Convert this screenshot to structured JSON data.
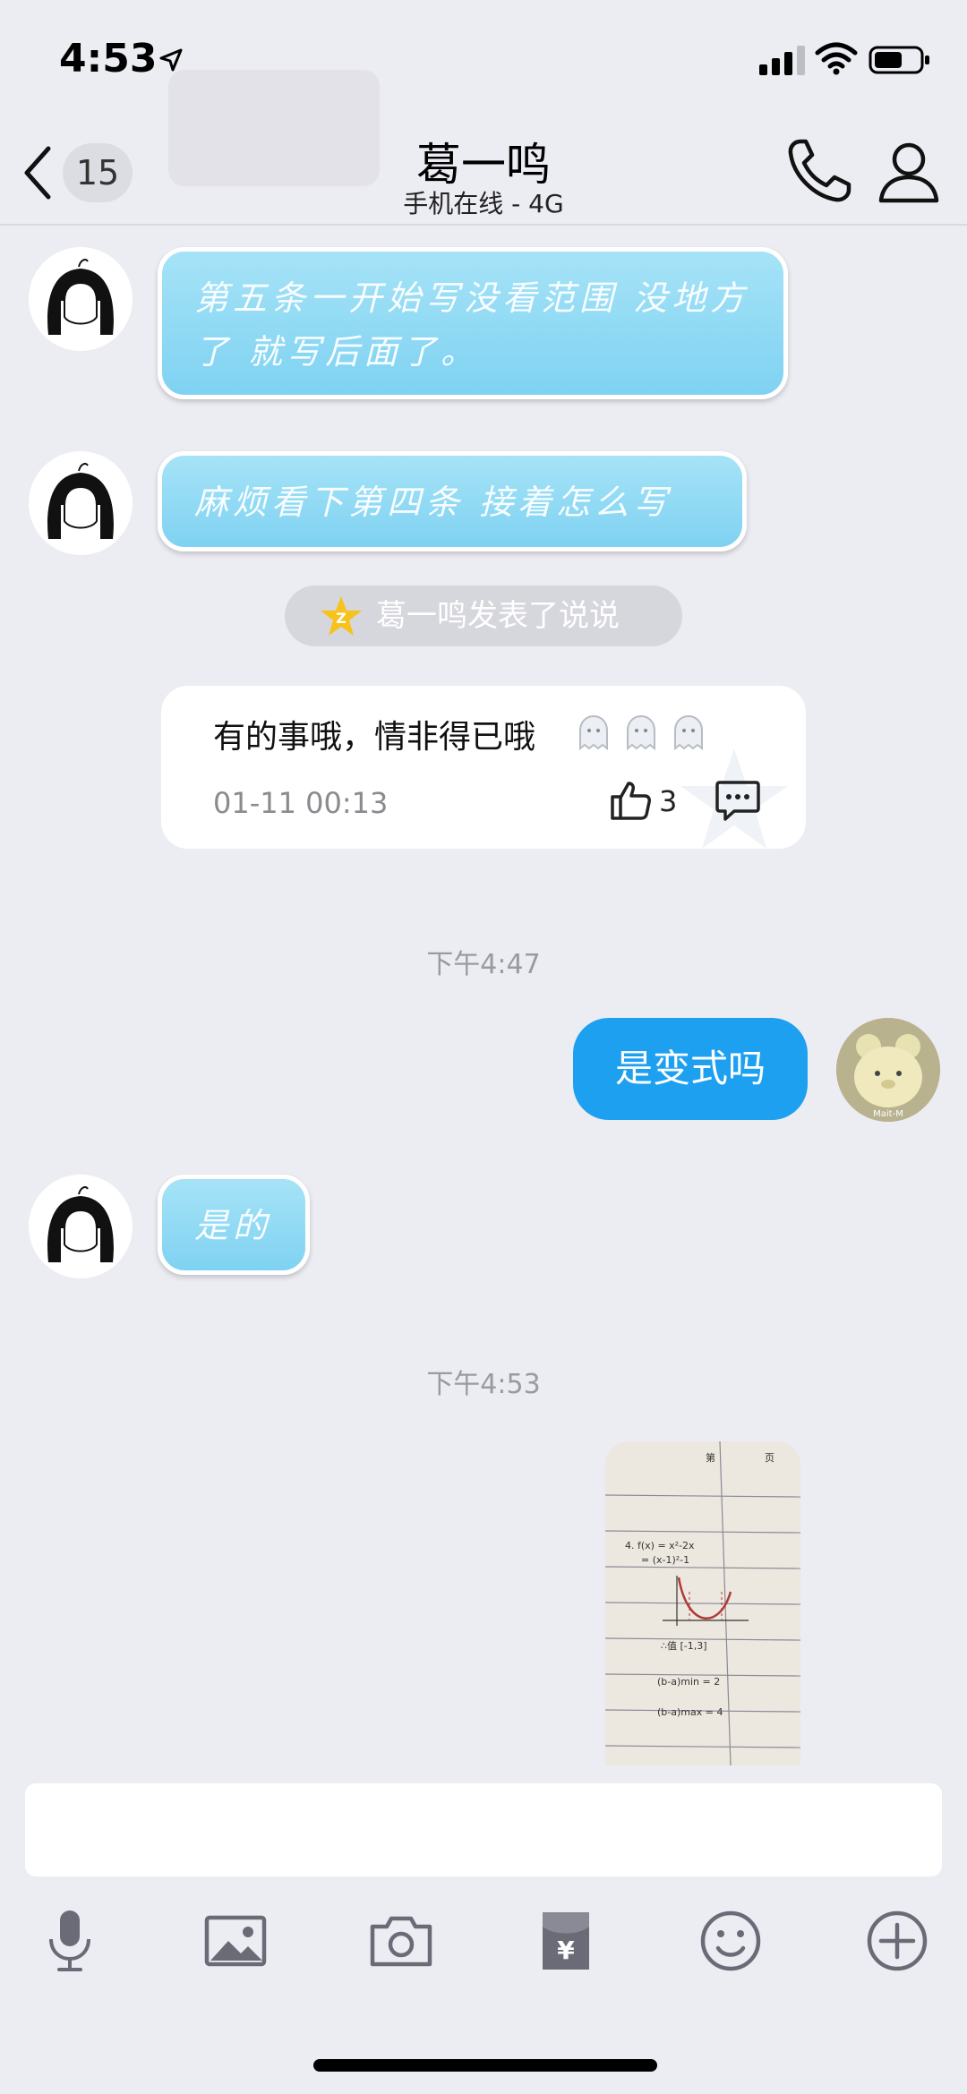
{
  "status_bar": {
    "time": "4:53"
  },
  "header": {
    "back_count": "15",
    "contact_name": "葛一鸣",
    "contact_status": "手机在线 - 4G"
  },
  "messages": [
    {
      "side": "left",
      "text": "第五条一开始写没看范围 没地方了 就写后面了。"
    },
    {
      "side": "left",
      "text": "麻烦看下第四条 接着怎么写"
    }
  ],
  "system_notice": {
    "text": "葛一鸣发表了说说"
  },
  "feed_card": {
    "text": "有的事哦，情非得已哦",
    "date": "01-11 00:13",
    "likes": "3"
  },
  "timestamps": [
    "下午4:47",
    "下午4:53"
  ],
  "reply_mine": "是变式吗",
  "reply_friend": "是的",
  "photo_note_lines": [
    "第",
    "页",
    "4. f(x) = x²-2x",
    "= (x-1)²-1",
    "∴值 [-1,3]",
    "(b-a)min = 2",
    "(b-a)max = 4"
  ],
  "avatar_caption": "Mait-M",
  "icons": {
    "back": "chevron-left-icon",
    "phone": "phone-icon",
    "profile": "person-icon",
    "qzone": "qzone-star-icon",
    "like": "thumbs-up-icon",
    "comment": "comment-icon",
    "toolbar": [
      "microphone-icon",
      "image-icon",
      "camera-icon",
      "red-packet-icon",
      "emoji-icon",
      "plus-icon"
    ]
  },
  "colors": {
    "background": "#ececf3",
    "my_bubble": "#1ea0f0",
    "friend_bubble": "#8fd8f4",
    "icon_gray": "#6b6b78"
  }
}
